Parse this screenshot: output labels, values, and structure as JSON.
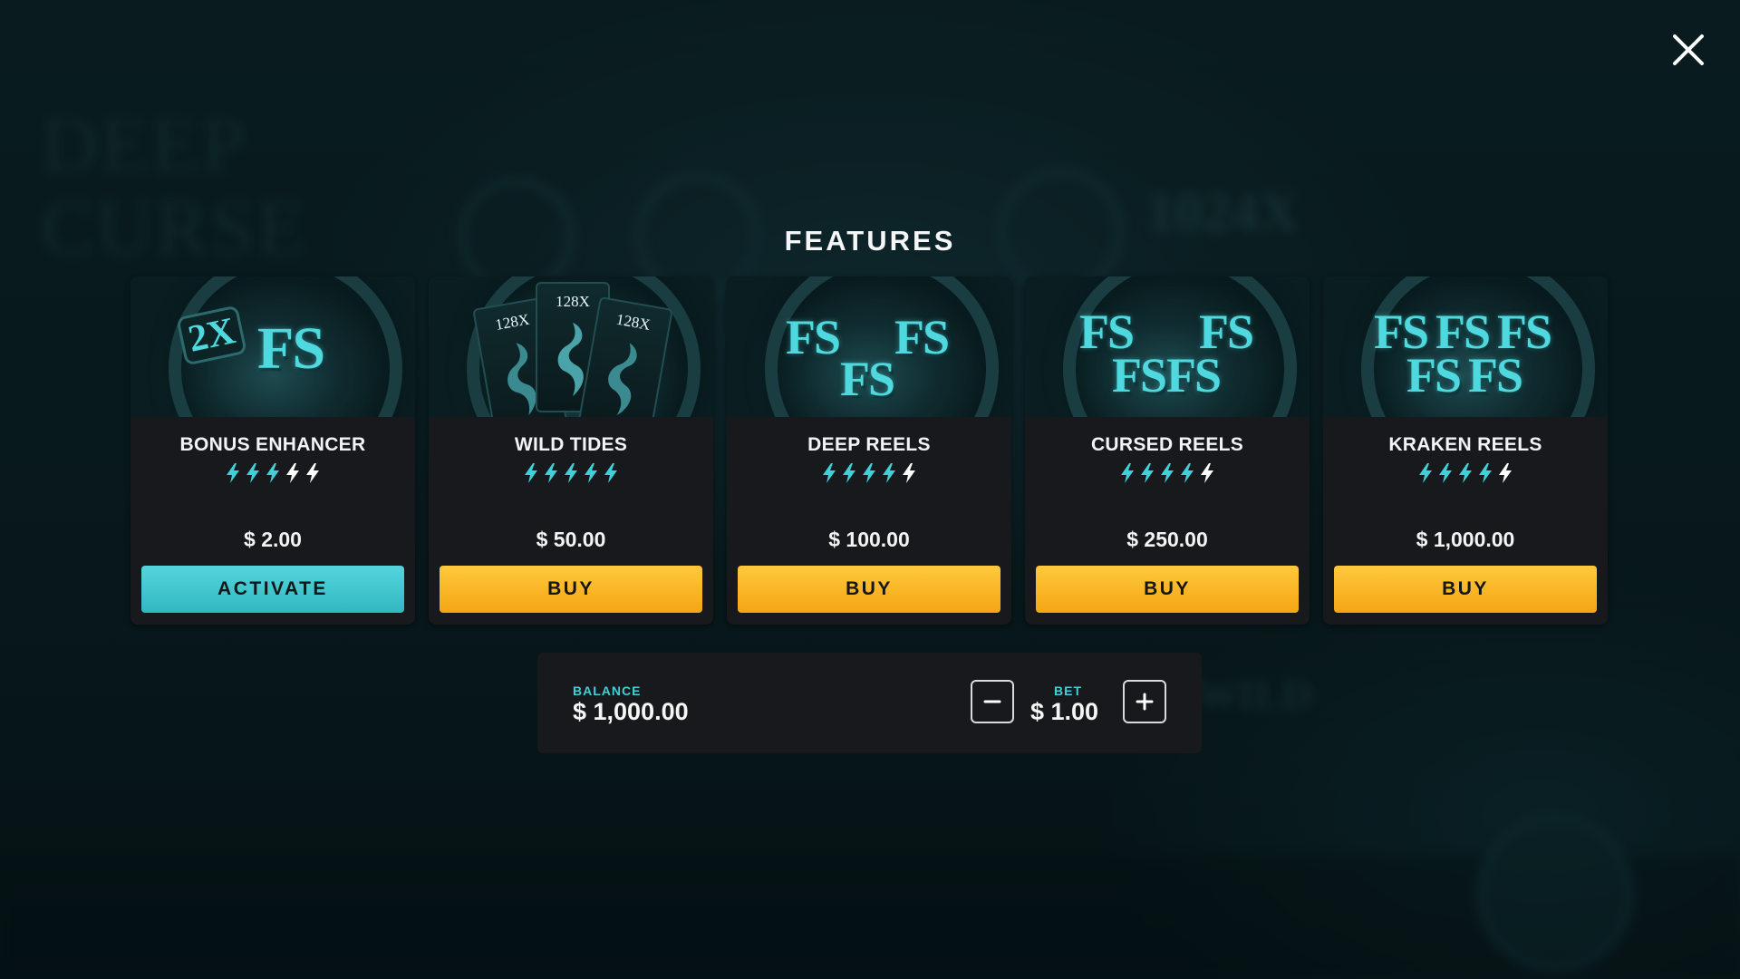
{
  "background": {
    "logo_line1": "DEEP",
    "logo_line2": "CURSE",
    "multiplier": "1024X",
    "wild": "WILD"
  },
  "close": {
    "icon": "close-icon"
  },
  "title": "FEATURES",
  "features": [
    {
      "name": "BONUS ENHANCER",
      "price": "$ 2.00",
      "action": "ACTIVATE",
      "bolts_active": 3,
      "bolts_total": 5,
      "art_badge": "2X",
      "art_text": "FS"
    },
    {
      "name": "WILD TIDES",
      "price": "$ 50.00",
      "action": "BUY",
      "bolts_active": 5,
      "bolts_total": 5,
      "art_cards": [
        "128X",
        "128X",
        "128X"
      ]
    },
    {
      "name": "DEEP REELS",
      "price": "$ 100.00",
      "action": "BUY",
      "bolts_active": 4,
      "bolts_total": 5,
      "art_text": "FS"
    },
    {
      "name": "CURSED REELS",
      "price": "$ 250.00",
      "action": "BUY",
      "bolts_active": 4,
      "bolts_total": 5,
      "art_text": "FS"
    },
    {
      "name": "KRAKEN REELS",
      "price": "$ 1,000.00",
      "action": "BUY",
      "bolts_active": 4,
      "bolts_total": 5,
      "art_text": "FS"
    }
  ],
  "footer": {
    "balance_label": "BALANCE",
    "balance_value": "$ 1,000.00",
    "bet_label": "BET",
    "bet_value": "$ 1.00",
    "minus_icon": "minus-icon",
    "plus_icon": "plus-icon"
  },
  "colors": {
    "accent_teal": "#3fd0d8",
    "buy_yellow": "#f5a512",
    "activate_teal": "#32b8c1",
    "bolt_active": "#3fd0d8",
    "bolt_inactive": "#ffffff",
    "card_bg": "#17191c"
  }
}
